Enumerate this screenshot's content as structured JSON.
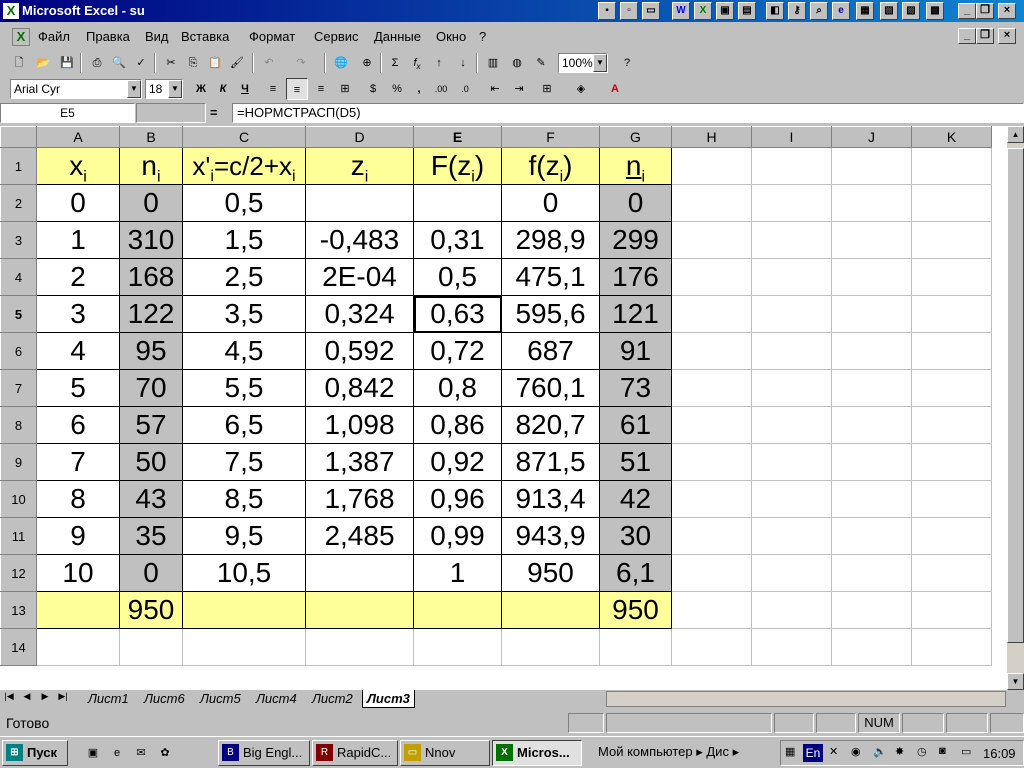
{
  "title": "Microsoft Excel - su",
  "menu": [
    "Файл",
    "Правка",
    "Вид",
    "Вставка",
    "Формат",
    "Сервис",
    "Данные",
    "Окно",
    "?"
  ],
  "font_name": "Arial Cyr",
  "font_size": "18",
  "zoom": "100%",
  "name_box": "E5",
  "formula": "=НОРМСТРАСП(D5)",
  "columns": [
    "A",
    "B",
    "C",
    "D",
    "E",
    "F",
    "G",
    "H",
    "I",
    "J",
    "K"
  ],
  "header_row": {
    "a": "x",
    "a_sub": "i",
    "b": "n",
    "b_sub": "i",
    "c": "x'",
    "c_sub": "i",
    "c_rest": "=c/2+x",
    "c_sub2": "i",
    "d": "z",
    "d_sub": "i",
    "e": "F(z",
    "e_sub": "i",
    "e_close": ")",
    "f": "f(z",
    "f_sub": "i",
    "f_close": ")",
    "g": "n",
    "g_sub": "i"
  },
  "rows": [
    {
      "n": "2",
      "a": "0",
      "b": "0",
      "c": "0,5",
      "d": "",
      "e": "",
      "f": "0",
      "g": "0"
    },
    {
      "n": "3",
      "a": "1",
      "b": "310",
      "c": "1,5",
      "d": "-0,483",
      "e": "0,31",
      "f": "298,9",
      "g": "299"
    },
    {
      "n": "4",
      "a": "2",
      "b": "168",
      "c": "2,5",
      "d": "2E-04",
      "e": "0,5",
      "f": "475,1",
      "g": "176"
    },
    {
      "n": "5",
      "a": "3",
      "b": "122",
      "c": "3,5",
      "d": "0,324",
      "e": "0,63",
      "f": "595,6",
      "g": "121"
    },
    {
      "n": "6",
      "a": "4",
      "b": "95",
      "c": "4,5",
      "d": "0,592",
      "e": "0,72",
      "f": "687",
      "g": "91"
    },
    {
      "n": "7",
      "a": "5",
      "b": "70",
      "c": "5,5",
      "d": "0,842",
      "e": "0,8",
      "f": "760,1",
      "g": "73"
    },
    {
      "n": "8",
      "a": "6",
      "b": "57",
      "c": "6,5",
      "d": "1,098",
      "e": "0,86",
      "f": "820,7",
      "g": "61"
    },
    {
      "n": "9",
      "a": "7",
      "b": "50",
      "c": "7,5",
      "d": "1,387",
      "e": "0,92",
      "f": "871,5",
      "g": "51"
    },
    {
      "n": "10",
      "a": "8",
      "b": "43",
      "c": "8,5",
      "d": "1,768",
      "e": "0,96",
      "f": "913,4",
      "g": "42"
    },
    {
      "n": "11",
      "a": "9",
      "b": "35",
      "c": "9,5",
      "d": "2,485",
      "e": "0,99",
      "f": "943,9",
      "g": "30"
    },
    {
      "n": "12",
      "a": "10",
      "b": "0",
      "c": "10,5",
      "d": "",
      "e": "1",
      "f": "950",
      "g": "6,1"
    }
  ],
  "total_row": {
    "n": "13",
    "b": "950",
    "g": "950"
  },
  "row14": "14",
  "row1": "1",
  "sheet_tabs": [
    "Лист1",
    "Лист6",
    "Лист5",
    "Лист4",
    "Лист2",
    "Лист3"
  ],
  "status": {
    "ready": "Готово",
    "num": "NUM"
  },
  "taskbar": {
    "start": "Пуск",
    "tasks": [
      "Big Engl...",
      "RapidC...",
      "Nnov",
      "Micros..."
    ],
    "my_computer": "Мой компьютер",
    "dis": "Дис",
    "lang": "En",
    "clock": "16:09"
  }
}
